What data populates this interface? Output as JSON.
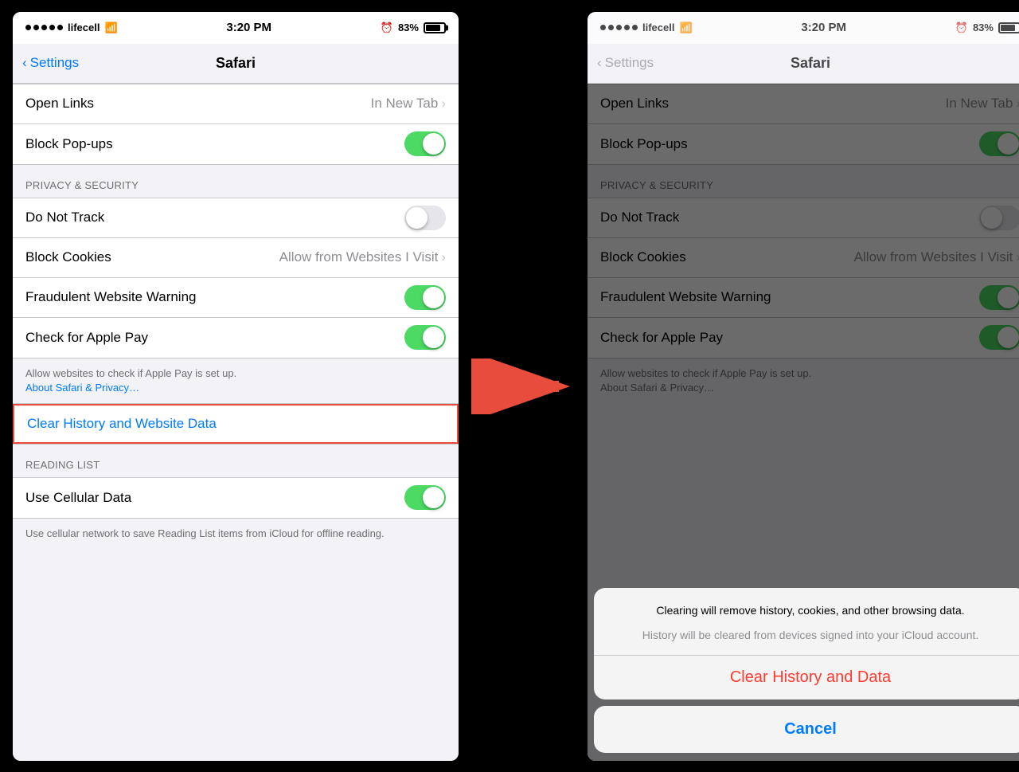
{
  "screen1": {
    "status": {
      "carrier": "lifecell",
      "time": "3:20 PM",
      "alarm": "⏰",
      "battery": "83%"
    },
    "nav": {
      "back_label": "Settings",
      "title": "Safari"
    },
    "rows": [
      {
        "id": "open-links",
        "label": "Open Links",
        "value": "In New Tab",
        "type": "nav"
      },
      {
        "id": "block-popups",
        "label": "Block Pop-ups",
        "type": "toggle",
        "on": true
      }
    ],
    "section_privacy": {
      "header": "PRIVACY & SECURITY",
      "rows": [
        {
          "id": "do-not-track",
          "label": "Do Not Track",
          "type": "toggle",
          "on": false
        },
        {
          "id": "block-cookies",
          "label": "Block Cookies",
          "value": "Allow from Websites I Visit",
          "type": "nav"
        },
        {
          "id": "fraudulent-warning",
          "label": "Fraudulent Website Warning",
          "type": "toggle",
          "on": true
        },
        {
          "id": "apple-pay",
          "label": "Check for Apple Pay",
          "type": "toggle",
          "on": true
        }
      ]
    },
    "footer_privacy": "Allow websites to check if Apple Pay is set up.",
    "footer_link": "About Safari & Privacy…",
    "clear_history": {
      "label": "Clear History and Website Data",
      "type": "blue_link",
      "has_border": true
    },
    "section_reading": {
      "header": "READING LIST",
      "rows": [
        {
          "id": "cellular-data",
          "label": "Use Cellular Data",
          "type": "toggle",
          "on": true
        }
      ]
    },
    "footer_reading": "Use cellular network to save Reading List items from iCloud for offline reading."
  },
  "screen2": {
    "status": {
      "carrier": "lifecell",
      "time": "3:20 PM",
      "alarm": "⏰",
      "battery": "83%"
    },
    "nav": {
      "back_label": "Settings",
      "title": "Safari"
    },
    "modal": {
      "message1": "Clearing will remove history, cookies, and other browsing data.",
      "message2": "History will be cleared from devices signed into your iCloud account.",
      "action_label": "Clear History and Data",
      "cancel_label": "Cancel"
    }
  },
  "arrow": {
    "color": "#e74c3c"
  }
}
